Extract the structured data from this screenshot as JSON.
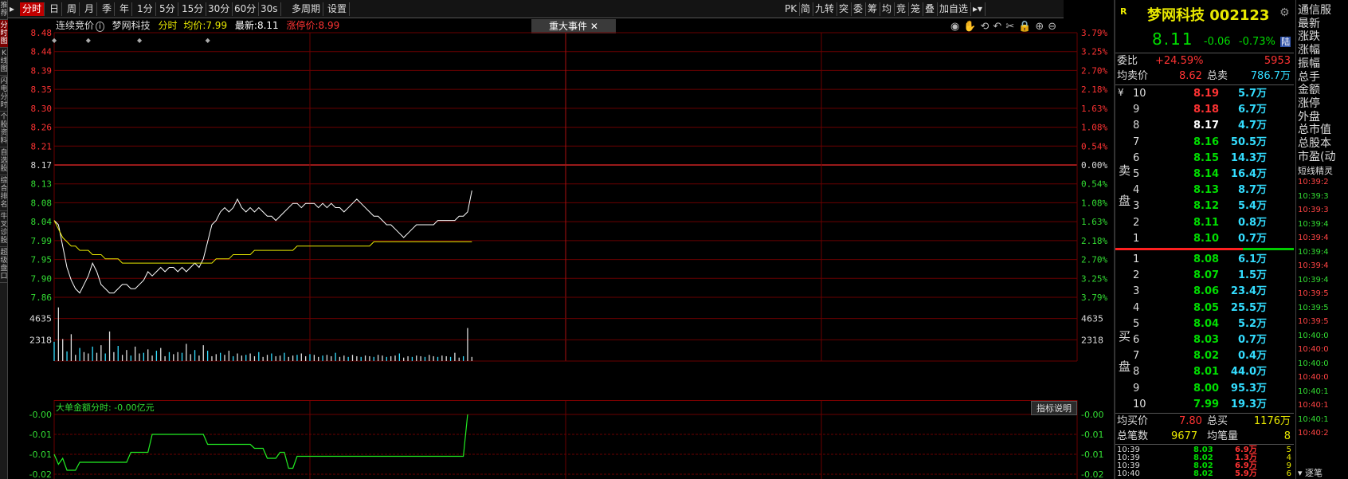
{
  "left_tabs": [
    "推荐",
    "分时图",
    "K线图",
    "闪电分时",
    "个股资料",
    "自选股",
    "综合排名",
    "牛叉诊股",
    "超级盘口"
  ],
  "toolbar": {
    "periods": [
      "分时",
      "日",
      "周",
      "月",
      "季",
      "年",
      "1分",
      "5分",
      "15分",
      "30分",
      "60分",
      "30s",
      "多周期",
      "设置"
    ],
    "right_items": [
      "PK",
      "简",
      "九转",
      "突",
      "委",
      "筹",
      "均",
      "竞",
      "笼",
      "叠",
      "加自选"
    ]
  },
  "info": {
    "phase": "连续竞价",
    "name": "梦网科技",
    "mode": "分时",
    "avg_label": "均价:",
    "avg_value": "7.99",
    "latest_label": "最新:",
    "latest_value": "8.11",
    "limit_label": "涨停价:",
    "limit_value": "8.99",
    "events_button": "重大事件"
  },
  "price_ticks": [
    "8.48",
    "8.44",
    "8.39",
    "8.35",
    "8.30",
    "8.26",
    "8.21",
    "8.17",
    "8.13",
    "8.08",
    "8.04",
    "7.99",
    "7.95",
    "7.90",
    "7.86"
  ],
  "pct_ticks": [
    "3.79%",
    "3.25%",
    "2.70%",
    "2.18%",
    "1.63%",
    "1.08%",
    "0.54%",
    "0.00%",
    "0.54%",
    "1.08%",
    "1.63%",
    "2.18%",
    "2.70%",
    "3.25%",
    "3.79%"
  ],
  "vol_ticks": [
    "4635",
    "2318"
  ],
  "indicator": {
    "title": "大单金额分时: -0.00亿元",
    "button": "指标说明",
    "ticks": [
      "-0.00",
      "-0.01",
      "-0.01",
      "-0.02"
    ]
  },
  "chart_data": {
    "type": "line",
    "title": "",
    "xlabel": "",
    "ylabel": "",
    "ylim": [
      7.86,
      8.48
    ],
    "prev_close": 8.17,
    "series": [
      {
        "values": [
          8.04,
          8.03,
          7.98,
          7.93,
          7.9,
          7.88,
          7.87,
          7.89,
          7.91,
          7.94,
          7.92,
          7.89,
          7.88,
          7.87,
          7.87,
          7.88,
          7.89,
          7.89,
          7.88,
          7.88,
          7.89,
          7.9,
          7.92,
          7.91,
          7.92,
          7.93,
          7.92,
          7.93,
          7.93,
          7.92,
          7.93,
          7.92,
          7.93,
          7.94,
          7.93,
          7.95,
          7.99,
          8.03,
          8.04,
          8.06,
          8.07,
          8.06,
          8.07,
          8.09,
          8.07,
          8.06,
          8.07,
          8.06,
          8.07,
          8.06,
          8.05,
          8.05,
          8.04,
          8.05,
          8.06,
          8.07,
          8.08,
          8.08,
          8.07,
          8.08,
          8.08,
          8.08,
          8.07,
          8.08,
          8.07,
          8.08,
          8.07,
          8.07,
          8.06,
          8.07,
          8.08,
          8.09,
          8.08,
          8.07,
          8.06,
          8.05,
          8.05,
          8.04,
          8.03,
          8.03,
          8.02,
          8.01,
          8.0,
          8.01,
          8.02,
          8.03,
          8.03,
          8.03,
          8.03,
          8.03,
          8.04,
          8.04,
          8.04,
          8.04,
          8.04,
          8.05,
          8.05,
          8.06,
          8.11
        ]
      },
      {
        "values": [
          8.04,
          8.02,
          8.0,
          7.99,
          7.98,
          7.98,
          7.97,
          7.97,
          7.97,
          7.96,
          7.96,
          7.96,
          7.95,
          7.95,
          7.95,
          7.95,
          7.94,
          7.94,
          7.94,
          7.94,
          7.94,
          7.94,
          7.94,
          7.94,
          7.94,
          7.94,
          7.94,
          7.94,
          7.94,
          7.94,
          7.94,
          7.94,
          7.94,
          7.94,
          7.94,
          7.94,
          7.94,
          7.94,
          7.95,
          7.95,
          7.95,
          7.95,
          7.96,
          7.96,
          7.96,
          7.96,
          7.96,
          7.97,
          7.97,
          7.97,
          7.97,
          7.97,
          7.97,
          7.97,
          7.97,
          7.97,
          7.97,
          7.98,
          7.98,
          7.98,
          7.98,
          7.98,
          7.98,
          7.98,
          7.98,
          7.98,
          7.98,
          7.98,
          7.98,
          7.98,
          7.98,
          7.98,
          7.98,
          7.98,
          7.98,
          7.99,
          7.99,
          7.99,
          7.99,
          7.99,
          7.99,
          7.99,
          7.99,
          7.99,
          7.99,
          7.99,
          7.99,
          7.99,
          7.99,
          7.99,
          7.99,
          7.99,
          7.99,
          7.99,
          7.99,
          7.99,
          7.99,
          7.99,
          7.99
        ]
      }
    ],
    "volumes": [
      2800,
      7800,
      3200,
      1400,
      3900,
      900,
      1900,
      1300,
      1100,
      2100,
      1200,
      2300,
      1100,
      4300,
      1300,
      2200,
      900,
      1600,
      800,
      2100,
      1100,
      1200,
      1700,
      800,
      1500,
      1900,
      700,
      1300,
      1000,
      1300,
      1200,
      2500,
      1000,
      1600,
      800,
      2300,
      1500,
      700,
      1000,
      1200,
      900,
      1500,
      700,
      1100,
      800,
      900,
      1100,
      700,
      1300,
      600,
      900,
      1100,
      700,
      800,
      1200,
      600,
      800,
      900,
      1100,
      700,
      1000,
      900,
      600,
      800,
      900,
      700,
      1200,
      600,
      800,
      600,
      900,
      700,
      600,
      800,
      700,
      600,
      900,
      800,
      600,
      700,
      800,
      1100,
      500,
      700,
      600,
      800,
      700,
      600,
      900,
      700,
      600,
      800,
      700,
      600,
      1200,
      500,
      700,
      4800,
      600
    ],
    "indicator_values": [
      -0.02,
      -0.025,
      -0.022,
      -0.028,
      -0.028,
      -0.028,
      -0.024,
      -0.024,
      -0.024,
      -0.024,
      -0.024,
      -0.024,
      -0.024,
      -0.024,
      -0.024,
      -0.024,
      -0.024,
      -0.024,
      -0.019,
      -0.019,
      -0.019,
      -0.019,
      -0.019,
      -0.01,
      -0.01,
      -0.01,
      -0.01,
      -0.01,
      -0.01,
      -0.01,
      -0.01,
      -0.01,
      -0.01,
      -0.01,
      -0.01,
      -0.01,
      -0.015,
      -0.015,
      -0.015,
      -0.015,
      -0.015,
      -0.015,
      -0.015,
      -0.015,
      -0.015,
      -0.015,
      -0.015,
      -0.017,
      -0.017,
      -0.017,
      -0.022,
      -0.022,
      -0.022,
      -0.019,
      -0.019,
      -0.027,
      -0.027,
      -0.021,
      -0.021,
      -0.021,
      -0.021,
      -0.021,
      -0.021,
      -0.021,
      -0.021,
      -0.021,
      -0.021,
      -0.021,
      -0.021,
      -0.021,
      -0.021,
      -0.021,
      -0.021,
      -0.021,
      -0.021,
      -0.021,
      -0.021,
      -0.021,
      -0.021,
      -0.021,
      -0.021,
      -0.021,
      -0.021,
      -0.021,
      -0.021,
      -0.021,
      -0.021,
      -0.021,
      -0.021,
      -0.021,
      -0.021,
      -0.021,
      -0.021,
      -0.021,
      -0.021,
      -0.021,
      -0.021,
      0.0
    ]
  },
  "quote": {
    "name": "梦网科技",
    "code": "002123",
    "price": "8.11",
    "change": "-0.06",
    "pct": "-0.73%",
    "hk_tag": "陆",
    "r_tag": "R",
    "weibi_label": "委比",
    "weibi": "+24.59%",
    "weicha": "5953",
    "avg_sell_label": "均卖价",
    "avg_sell": "8.62",
    "total_sell_label": "总卖",
    "total_sell": "786.7万",
    "sell_side_label": "卖盘",
    "buy_side_label": "买盘",
    "currency": "¥",
    "asks": [
      {
        "lvl": "10",
        "p": "8.19",
        "v": "5.7万"
      },
      {
        "lvl": "9",
        "p": "8.18",
        "v": "6.7万"
      },
      {
        "lvl": "8",
        "p": "8.17",
        "v": "4.7万"
      },
      {
        "lvl": "7",
        "p": "8.16",
        "v": "50.5万"
      },
      {
        "lvl": "6",
        "p": "8.15",
        "v": "14.3万"
      },
      {
        "lvl": "5",
        "p": "8.14",
        "v": "16.4万"
      },
      {
        "lvl": "4",
        "p": "8.13",
        "v": "8.7万"
      },
      {
        "lvl": "3",
        "p": "8.12",
        "v": "5.4万"
      },
      {
        "lvl": "2",
        "p": "8.11",
        "v": "0.8万"
      },
      {
        "lvl": "1",
        "p": "8.10",
        "v": "0.7万"
      }
    ],
    "bids": [
      {
        "lvl": "1",
        "p": "8.08",
        "v": "6.1万"
      },
      {
        "lvl": "2",
        "p": "8.07",
        "v": "1.5万"
      },
      {
        "lvl": "3",
        "p": "8.06",
        "v": "23.4万"
      },
      {
        "lvl": "4",
        "p": "8.05",
        "v": "25.5万"
      },
      {
        "lvl": "5",
        "p": "8.04",
        "v": "5.2万"
      },
      {
        "lvl": "6",
        "p": "8.03",
        "v": "0.7万"
      },
      {
        "lvl": "7",
        "p": "8.02",
        "v": "0.4万"
      },
      {
        "lvl": "8",
        "p": "8.01",
        "v": "44.0万"
      },
      {
        "lvl": "9",
        "p": "8.00",
        "v": "95.3万"
      },
      {
        "lvl": "10",
        "p": "7.99",
        "v": "19.3万"
      }
    ],
    "avg_buy_label": "均买价",
    "avg_buy": "7.80",
    "total_buy_label": "总买",
    "total_buy": "1176万",
    "total_trades_label": "总笔数",
    "total_trades": "9677",
    "avg_trade_label": "均笔量",
    "avg_trade": "8",
    "trades": [
      {
        "t": "10:39",
        "p": "8.03",
        "v": "6.9万",
        "n": "5"
      },
      {
        "t": "10:39",
        "p": "8.02",
        "v": "1.3万",
        "n": "4"
      },
      {
        "t": "10:39",
        "p": "8.02",
        "v": "6.9万",
        "n": "9"
      },
      {
        "t": "10:40",
        "p": "8.02",
        "v": "5.9万",
        "n": "6"
      }
    ]
  },
  "side": {
    "labels": [
      "通信服",
      "最新",
      "涨跌",
      "涨幅",
      "振幅",
      "总手",
      "金额",
      "涨停",
      "外盘",
      "总市值",
      "总股本",
      "市盈(动"
    ],
    "short_title": "短线精灵",
    "ticks": [
      "10:39:2",
      "10:39:3",
      "10:39:3",
      "10:39:4",
      "10:39:4",
      "10:39:4",
      "10:39:4",
      "10:39:4",
      "10:39:5",
      "10:39:5",
      "10:39:5",
      "10:40:0",
      "10:40:0",
      "10:40:0",
      "10:40:0",
      "10:40:1",
      "10:40:1",
      "10:40:1",
      "10:40:2"
    ],
    "bottom_tab": "逐笔"
  }
}
